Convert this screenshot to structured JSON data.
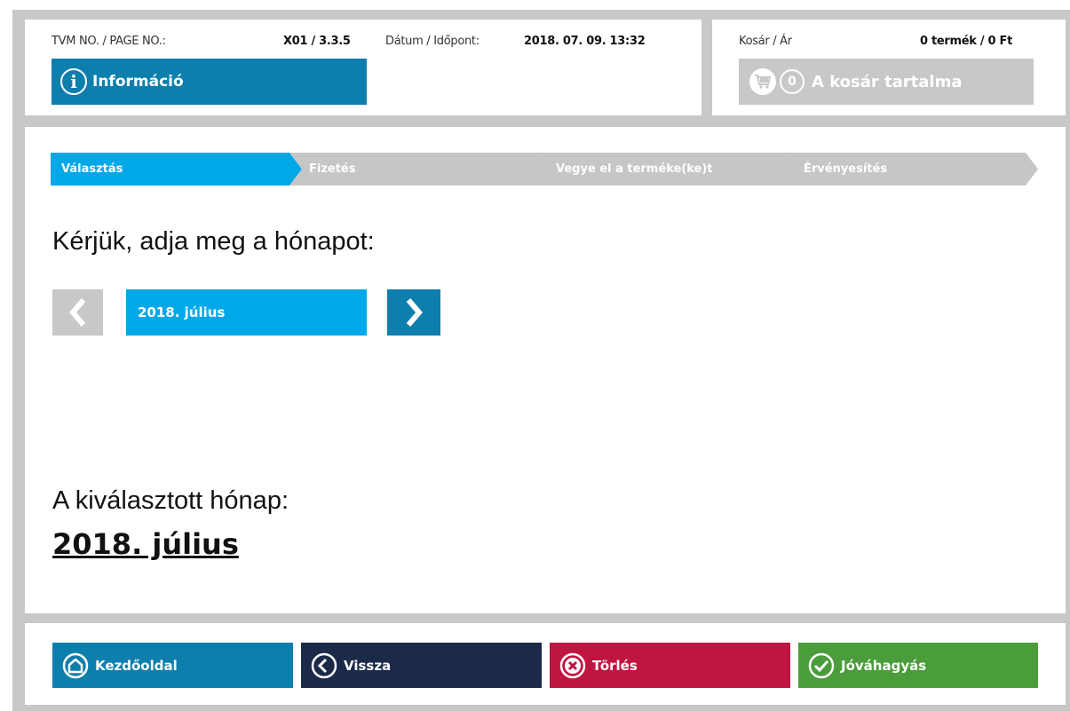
{
  "header": {
    "tvm_label": "TVM NO. / PAGE NO.:",
    "tvm_value": "X01 / 3.3.5",
    "datetime_label": "Dátum / Időpont:",
    "datetime_value": "2018. 07. 09. 13:32",
    "info_button": "Információ",
    "info_icon": "info-icon",
    "cart_label": "Kosár / Ár",
    "cart_value": "0 termék / 0 Ft",
    "cart_count": "0",
    "cart_button": "A kosár tartalma",
    "cart_icon": "cart-icon"
  },
  "steps": [
    {
      "label": "Választás",
      "state": "active"
    },
    {
      "label": "Fizetés",
      "state": "inactive"
    },
    {
      "label": "Vegye el a terméke(ke)t",
      "state": "inactive"
    },
    {
      "label": "Érvényesítés",
      "state": "inactive"
    }
  ],
  "main": {
    "prompt": "Kérjük, adja meg a hónapot:",
    "month_value": "2018. július",
    "prev_icon": "chevron-left-icon",
    "next_icon": "chevron-right-icon",
    "selected_label": "A kiválasztott hónap:",
    "selected_value": "2018. július"
  },
  "footer": {
    "home": "Kezdőoldal",
    "back": "Vissza",
    "delete": "Törlés",
    "confirm": "Jóváhagyás"
  },
  "colors": {
    "primary_blue": "#0e7fad",
    "active_blue": "#00a8e8",
    "inactive_grey": "#c6c6c6",
    "navy": "#1c2a4a",
    "red": "#bf1541",
    "green": "#4a9d3a"
  }
}
